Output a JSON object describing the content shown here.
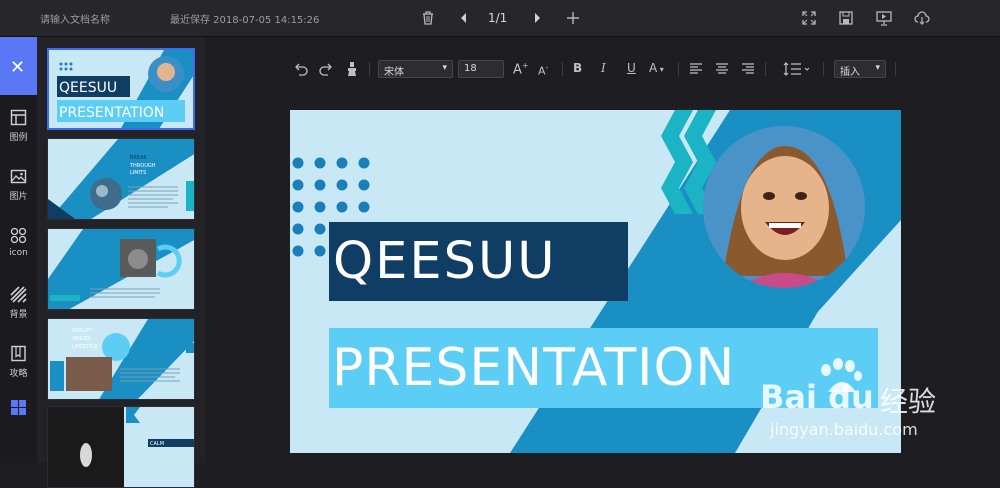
{
  "topbar": {
    "doc_name_placeholder": "请输入文档名称",
    "save_time": "最近保存 2018-07-05 14:15:26",
    "page_indicator": "1/1",
    "icons": [
      "trash-icon",
      "prev-page-icon",
      "next-page-icon",
      "add-page-icon",
      "fullscreen-icon",
      "save-icon",
      "present-icon",
      "cloud-download-icon"
    ]
  },
  "leftnav": {
    "items": [
      {
        "label": "图例",
        "icon": "layout-icon"
      },
      {
        "label": "图片",
        "icon": "image-icon"
      },
      {
        "label": "icon",
        "icon": "icons-icon"
      },
      {
        "label": "背景",
        "icon": "background-icon"
      },
      {
        "label": "攻略",
        "icon": "guide-icon"
      }
    ],
    "accent": "#5a78f5"
  },
  "thumbnails": {
    "slide1": {
      "line1": "QEESUU",
      "line2": "PRESENTATION"
    },
    "slide2": {
      "line1": "BREAK",
      "line2": "THROUGH",
      "line3": "LIMITS"
    },
    "slide4": {
      "line1": "REALITY",
      "line2": "SMILES",
      "line3": "LIFESTYLE"
    },
    "slide5": {
      "line1": "CALM"
    }
  },
  "toolbar": {
    "font_family": "宋体",
    "font_size": "18",
    "bold": "B",
    "italic": "I",
    "underline": "U",
    "font_color": "A",
    "increase_font": "A",
    "decrease_font": "A",
    "insert_label": "插入"
  },
  "slide": {
    "title_line1": "QEESUU",
    "title_line2": "PRESENTATION",
    "colors": {
      "bg": "#c9e8f5",
      "dark": "#0f3d63",
      "mid": "#1a8fc4",
      "light": "#5ccdf5",
      "dots": "#1a7fb8"
    }
  },
  "watermark": {
    "brand": "Bai du",
    "brand_cn": "经验",
    "url": "jingyan.baidu.com"
  }
}
